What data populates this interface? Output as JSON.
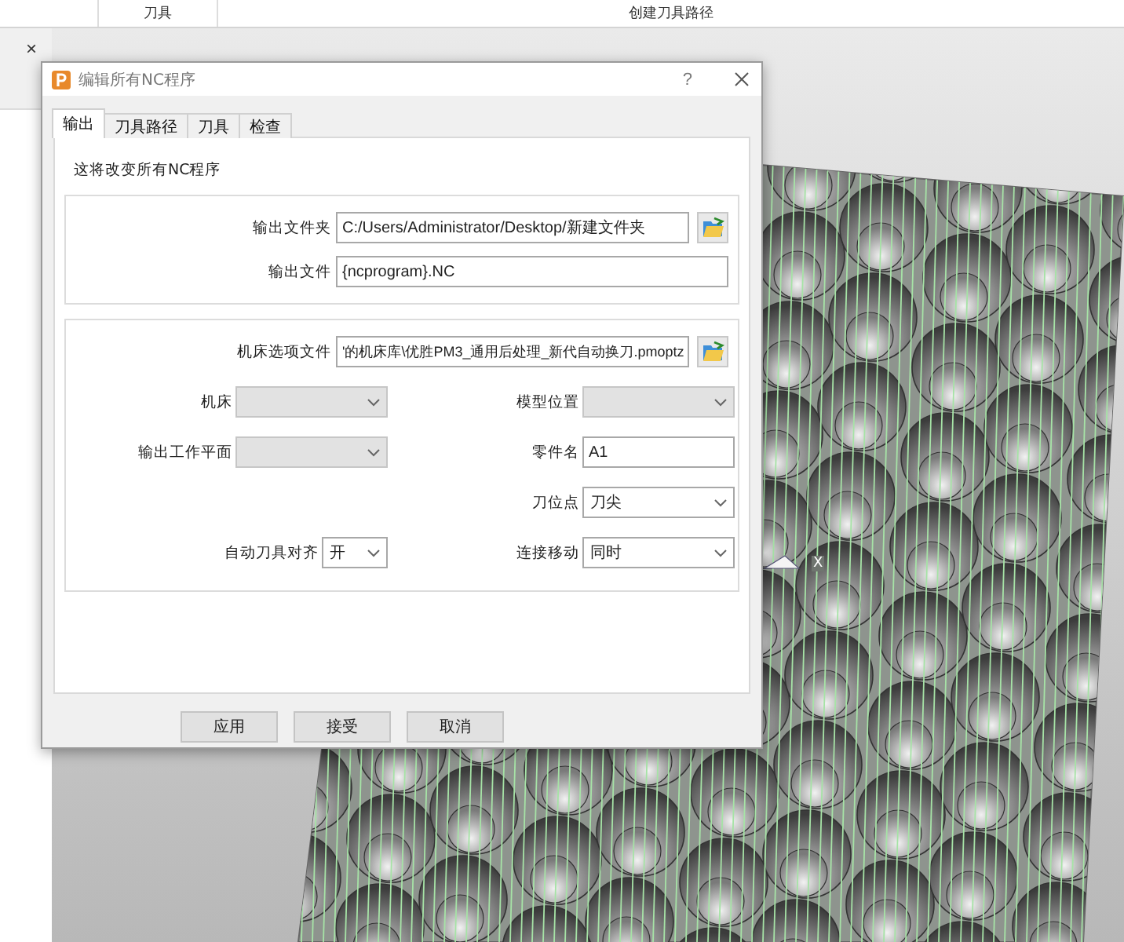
{
  "ribbon": {
    "columns": [
      "刀具",
      "创建刀具路径"
    ]
  },
  "side_panel": {
    "close": "×"
  },
  "viewport": {
    "axis_label": "X"
  },
  "dialog": {
    "title": "编辑所有NC程序",
    "help": "?",
    "tabs": [
      {
        "label": "输出",
        "selected": true
      },
      {
        "label": "刀具路径",
        "selected": false
      },
      {
        "label": "刀具",
        "selected": false
      },
      {
        "label": "检查",
        "selected": false
      }
    ],
    "note": "这将改变所有NC程序",
    "output_group": [
      {
        "label": "输出文件夹",
        "value": "C:/Users/Administrator/Desktop/新建文件夹",
        "browse": true
      },
      {
        "label": "输出文件",
        "value": "{ncprogram}.NC",
        "browse": false
      }
    ],
    "option_file": {
      "label": "机床选项文件",
      "value": "'的机床库\\优胜PM3_通用后处理_新代自动换刀.pmoptz"
    },
    "rows": [
      {
        "left": {
          "label": "机床",
          "kind": "select",
          "disabled": true
        },
        "right": {
          "label": "模型位置",
          "kind": "select",
          "disabled": true
        }
      },
      {
        "left": {
          "label": "输出工作平面",
          "kind": "select",
          "disabled": true
        },
        "right": {
          "label": "零件名",
          "kind": "input",
          "value": "A1",
          "disabled": false
        }
      },
      {
        "right": {
          "label": "刀位点",
          "kind": "select",
          "value": "刀尖",
          "disabled": false
        }
      },
      {
        "left": {
          "label": "自动刀具对齐",
          "kind": "select",
          "value": "开",
          "disabled": false
        },
        "right": {
          "label": "连接移动",
          "kind": "select",
          "value": "同时",
          "disabled": false
        }
      }
    ],
    "buttons": [
      "应用",
      "接受",
      "取消"
    ]
  }
}
